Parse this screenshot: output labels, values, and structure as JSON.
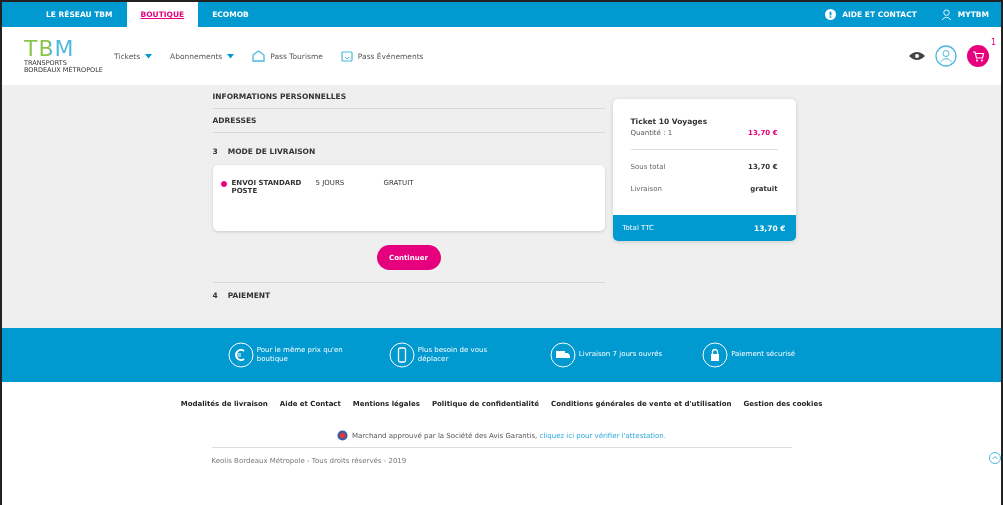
{
  "top_tabs": [
    {
      "label": "LE RÉSEAU TBM",
      "selected": false
    },
    {
      "label": "BOUTIQUE",
      "selected": true
    },
    {
      "label": "ECOMOB",
      "selected": false
    }
  ],
  "top_links": [
    {
      "kind": "help",
      "label": "AIDE ET CONTACT"
    },
    {
      "kind": "user",
      "label": "MYTBM"
    }
  ],
  "logo": {
    "text": "TBM",
    "subtitle": "TRANSPORTS BORDEAUX MÉTROPOLE"
  },
  "nav": [
    {
      "kind": "dropdown",
      "label": "Tickets"
    },
    {
      "kind": "dropdown",
      "label": "Abonnements"
    },
    {
      "kind": "house",
      "label": "Pass Tourisme"
    },
    {
      "kind": "calendar",
      "label": "Pass Événements"
    }
  ],
  "cart": {
    "count": "1"
  },
  "steps": [
    {
      "kind": "done",
      "title": "INFORMATIONS PERSONNELLES"
    },
    {
      "kind": "done",
      "title": "ADRESSES"
    },
    {
      "kind": "current",
      "number": "3",
      "title": "MODE DE LIVRAISON"
    },
    {
      "kind": "todo",
      "number": "4",
      "title": "PAIEMENT"
    }
  ],
  "delivery_options": [
    {
      "name": "ENVOI STANDARD POSTE",
      "delay": "5 JOURS",
      "price": "GRATUIT",
      "selected": true
    }
  ],
  "continue_button": "Continuer",
  "summary": {
    "item": "Ticket 10 Voyages",
    "quantity": "Quantité : 1",
    "item_price": "13,70 €",
    "rows": [
      {
        "label": "Sous total",
        "value": "13,70 €"
      },
      {
        "label": "Livraison",
        "value": "gratuit"
      }
    ],
    "total_label": "Total TTC",
    "total_value": "13,70 €"
  },
  "features": [
    {
      "kind": "euro",
      "text": "Pour le même prix qu'en boutique"
    },
    {
      "kind": "phone",
      "text": "Plus besoin de vous déplacer"
    },
    {
      "kind": "truck",
      "text": "Livraison 7 jours ouvrés"
    },
    {
      "kind": "lock",
      "text": "Paiement sécurisé"
    }
  ],
  "footer_links": [
    "Modalités de livraison",
    "Aide et Contact",
    "Mentions légales",
    "Politique de confidentialité",
    "Conditions générales de vente et d'utilisation",
    "Gestion des cookies"
  ],
  "trust": {
    "text": "Marchand approuvé par la Société des Avis Garantis, ",
    "link": "cliquez ici pour vérifier l'attestation."
  },
  "copyright": "Keolis Bordeaux Métropole - Tous droits réservés - 2019"
}
